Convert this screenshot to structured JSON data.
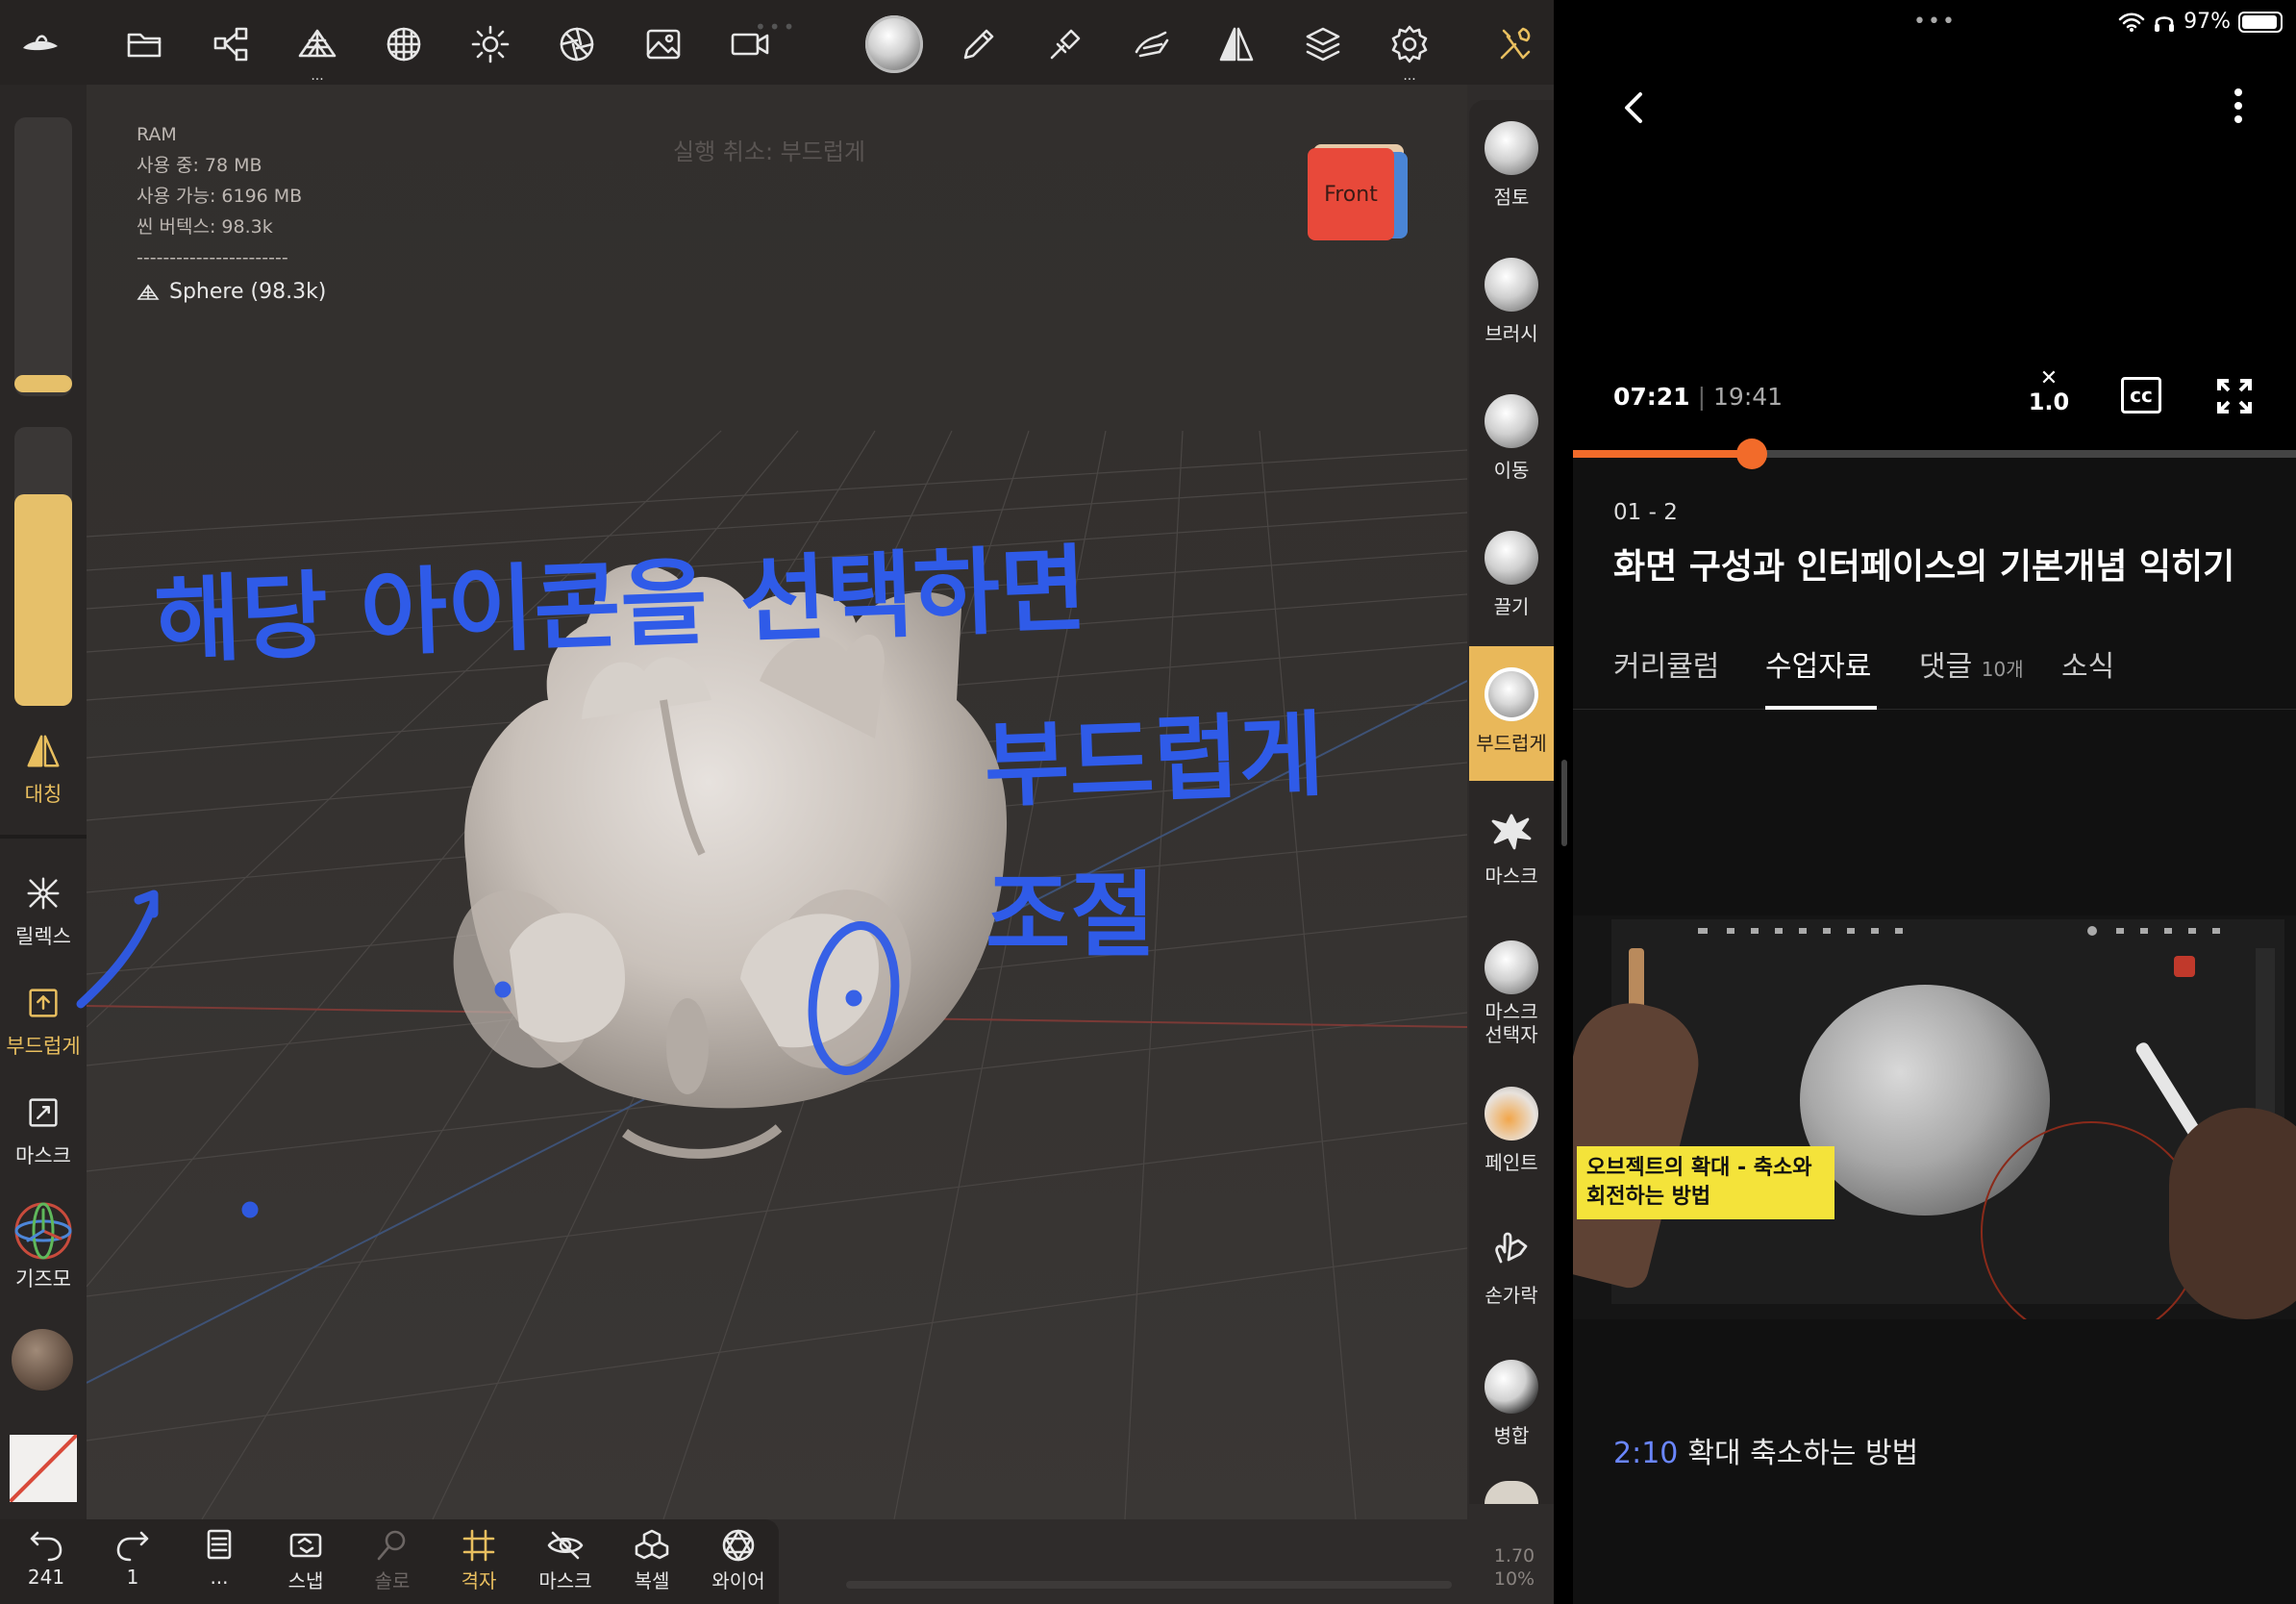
{
  "nomad": {
    "topbar_icons": [
      "home-icon",
      "folder-icon",
      "scene-graph-icon",
      "mesh-icon",
      "sphere-grid-icon",
      "light-icon",
      "shading-icon",
      "background-image-icon",
      "video-icon",
      "current-brush-icon",
      "pen-icon",
      "stroke-icon",
      "hand-tool-icon",
      "symmetry-icon",
      "layers-icon",
      "settings-icon",
      "interface-tools-icon"
    ],
    "stats": {
      "ram": "RAM",
      "in_use": "사용 중: 78 MB",
      "available": "사용 가능: 6196 MB",
      "scene_vertices": "씬 버텍스: 98.3k",
      "dashes": "-----------------------",
      "object": "Sphere (98.3k)"
    },
    "undo_hint": "실행 취소: 부드럽게",
    "cube_label": "Front",
    "left_sidebar": {
      "symmetry": "대칭",
      "relax": "릴렉스",
      "smooth": "부드럽게",
      "mask": "마스크",
      "gizmo": "기즈모"
    },
    "tools": [
      {
        "name": "clay",
        "label": "점토"
      },
      {
        "name": "brush",
        "label": "브러시"
      },
      {
        "name": "move",
        "label": "이동"
      },
      {
        "name": "drag",
        "label": "끌기"
      },
      {
        "name": "smooth",
        "label": "부드럽게"
      },
      {
        "name": "mask",
        "label": "마스크"
      },
      {
        "name": "mask-selector",
        "label": "마스크\n선택자"
      },
      {
        "name": "paint",
        "label": "페인트"
      },
      {
        "name": "finger",
        "label": "손가락"
      },
      {
        "name": "merge",
        "label": "병합"
      }
    ],
    "bottom": {
      "undo_count": "241",
      "redo_count": "1",
      "more": "...",
      "snap": "스냅",
      "solo": "솔로",
      "grid": "격자",
      "mask": "마스크",
      "voxel": "복셀",
      "wireframe": "와이어"
    },
    "zoom": {
      "value": "1.70",
      "percent": "10%"
    },
    "annotation": {
      "line1": "해당 아이콘을 선택하면",
      "line2": "부드럽게",
      "line3": "조절"
    }
  },
  "player": {
    "status": {
      "battery": "97%"
    },
    "current_time": "07:21",
    "total_time": "19:41",
    "speed": "1.0",
    "cc": "cc",
    "progress_fraction": 0.248,
    "lecture_number": "01 - 2",
    "lecture_title": "화면 구성과 인터페이스의 기본개념 익히기",
    "tabs": [
      {
        "label": "커리큘럼"
      },
      {
        "label": "수업자료",
        "active": true
      },
      {
        "label": "댓글",
        "count": "10개"
      },
      {
        "label": "소식"
      }
    ],
    "thumbnail_caption": "오브젝트의 확대 - 축소와 회전하는 방법",
    "chapter": {
      "time": "2:10",
      "title": "확대 축소하는 방법"
    }
  },
  "colors": {
    "accent_orange": "#f26b2a",
    "nomad_accent": "#e9bf5f",
    "ink_blue": "#2f5be8"
  }
}
